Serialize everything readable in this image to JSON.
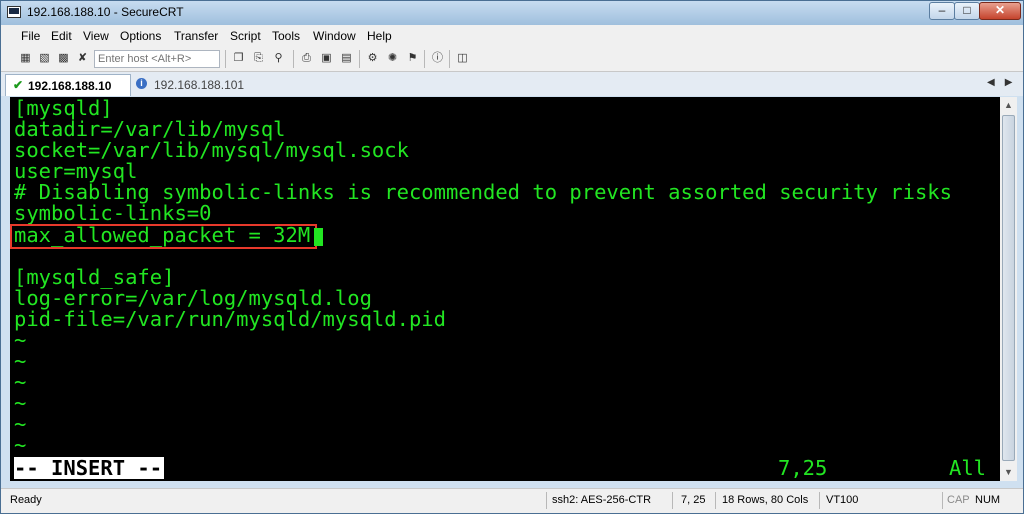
{
  "window": {
    "title": "192.168.188.10 - SecureCRT"
  },
  "menu": [
    "File",
    "Edit",
    "View",
    "Options",
    "Transfer",
    "Script",
    "Tools",
    "Window",
    "Help"
  ],
  "toolbar": {
    "host_placeholder": "Enter host <Alt+R>",
    "icons": [
      "connect-icon",
      "quick-connect-icon",
      "disconnect-icon",
      "copy-icon",
      "paste-icon",
      "find-icon",
      "print-icon",
      "session-options-icon",
      "global-options-icon",
      "keymap-icon",
      "help-icon",
      "screen-icon"
    ]
  },
  "tabs": [
    {
      "label": "192.168.188.10",
      "active": true,
      "status_icon": "check-icon"
    },
    {
      "label": "192.168.188.101",
      "active": false,
      "status_icon": "info-icon"
    }
  ],
  "terminal": {
    "lines": [
      "[mysqld]",
      "datadir=/var/lib/mysql",
      "socket=/var/lib/mysql/mysql.sock",
      "user=mysql",
      "# Disabling symbolic-links is recommended to prevent assorted security risks",
      "symbolic-links=0",
      "max_allowed_packet = 32M",
      "",
      "[mysqld_safe]",
      "log-error=/var/log/mysqld.log",
      "pid-file=/var/run/mysqld/mysqld.pid",
      "~",
      "~",
      "~",
      "~",
      "~",
      "~"
    ],
    "mode": "-- INSERT --",
    "cursor_position": "7,25",
    "scroll_indicator": "All",
    "text_color": "#22e622",
    "background_color": "#000000",
    "highlight_color": "#e8392b"
  },
  "status": {
    "ready": "Ready",
    "cipher": "ssh2: AES-256-CTR",
    "position": "7,  25",
    "size": "18 Rows, 80 Cols",
    "emulation": "VT100",
    "caps": "CAP",
    "num": "NUM"
  }
}
